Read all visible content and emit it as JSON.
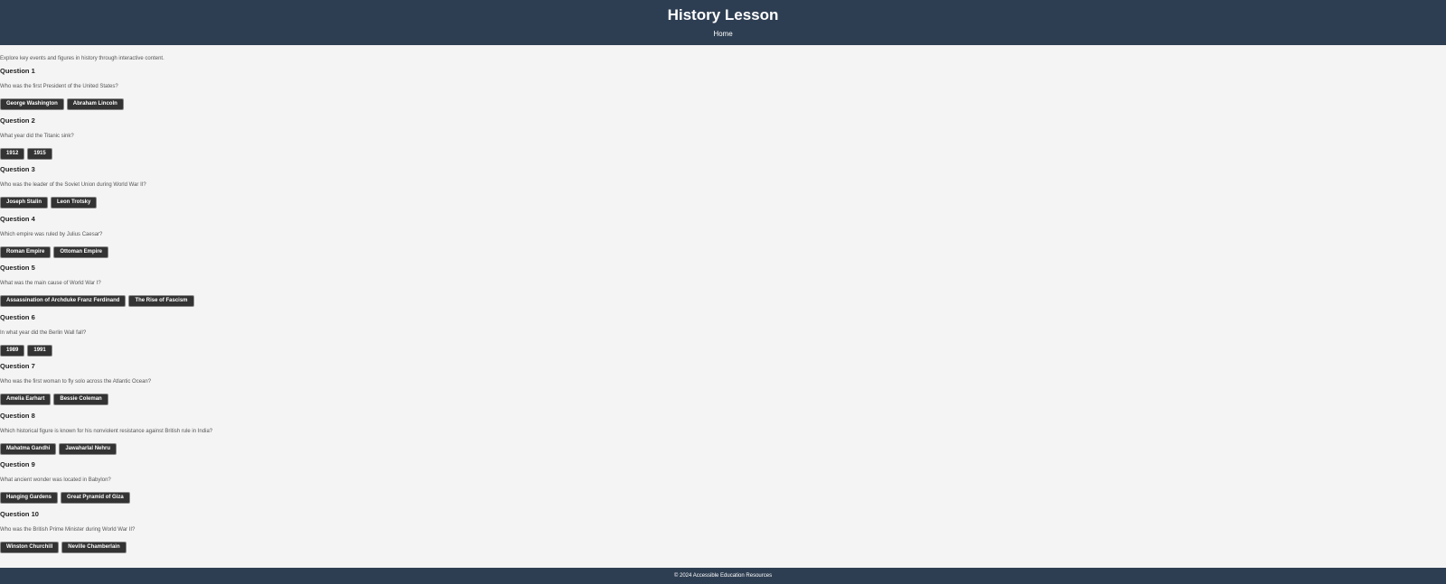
{
  "header": {
    "title": "History Lesson",
    "nav_home": "Home"
  },
  "main": {
    "intro": "Explore key events and figures in history through interactive content.",
    "questions": [
      {
        "title": "Question 1",
        "text": "Who was the first President of the United States?",
        "answers": [
          "George Washington",
          "Abraham Lincoln"
        ]
      },
      {
        "title": "Question 2",
        "text": "What year did the Titanic sink?",
        "answers": [
          "1912",
          "1915"
        ]
      },
      {
        "title": "Question 3",
        "text": "Who was the leader of the Soviet Union during World War II?",
        "answers": [
          "Joseph Stalin",
          "Leon Trotsky"
        ]
      },
      {
        "title": "Question 4",
        "text": "Which empire was ruled by Julius Caesar?",
        "answers": [
          "Roman Empire",
          "Ottoman Empire"
        ]
      },
      {
        "title": "Question 5",
        "text": "What was the main cause of World War I?",
        "answers": [
          "Assassination of Archduke Franz Ferdinand",
          "The Rise of Fascism"
        ]
      },
      {
        "title": "Question 6",
        "text": "In what year did the Berlin Wall fall?",
        "answers": [
          "1989",
          "1991"
        ]
      },
      {
        "title": "Question 7",
        "text": "Who was the first woman to fly solo across the Atlantic Ocean?",
        "answers": [
          "Amelia Earhart",
          "Bessie Coleman"
        ]
      },
      {
        "title": "Question 8",
        "text": "Which historical figure is known for his nonviolent resistance against British rule in India?",
        "answers": [
          "Mahatma Gandhi",
          "Jawaharlal Nehru"
        ]
      },
      {
        "title": "Question 9",
        "text": "What ancient wonder was located in Babylon?",
        "answers": [
          "Hanging Gardens",
          "Great Pyramid of Giza"
        ]
      },
      {
        "title": "Question 10",
        "text": "Who was the British Prime Minister during World War II?",
        "answers": [
          "Winston Churchill",
          "Neville Chamberlain"
        ]
      }
    ]
  },
  "footer": {
    "text": "© 2024 Accessible Education Resources"
  },
  "colors": {
    "header_bg": "#2e3e52",
    "page_bg": "#f4f4f5",
    "button_bg": "#333333"
  }
}
